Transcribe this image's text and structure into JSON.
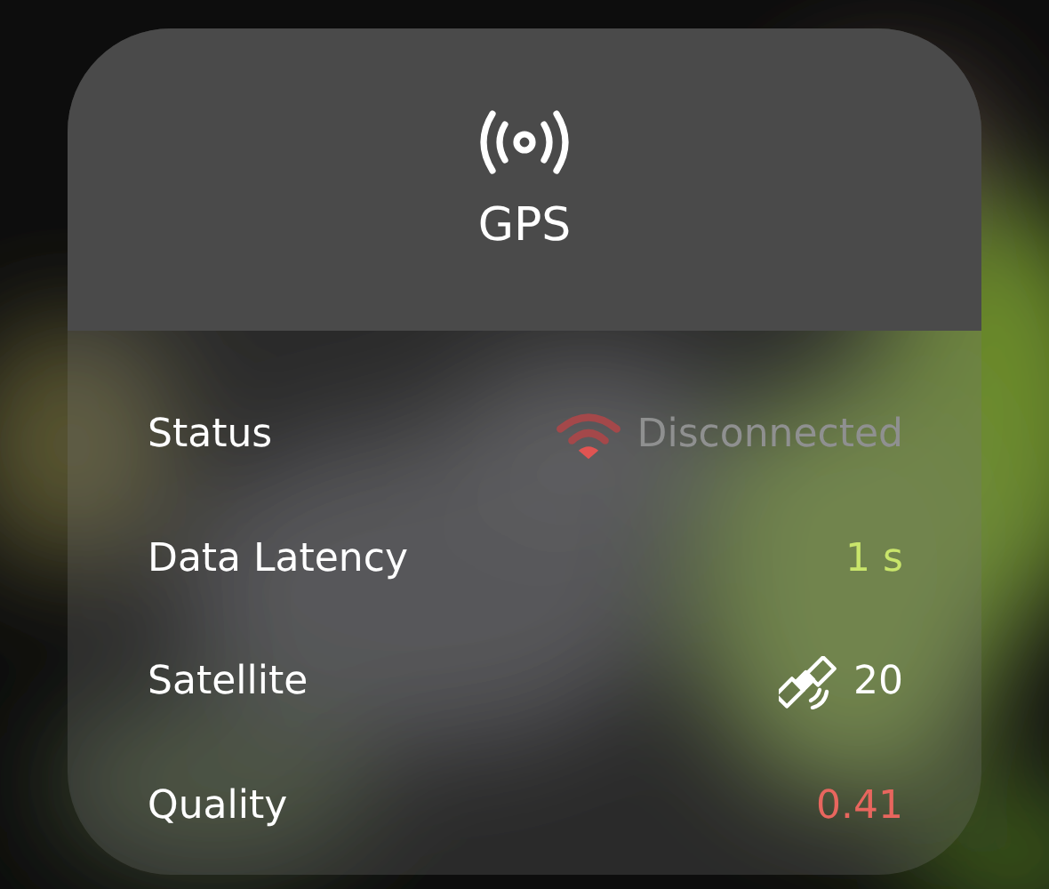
{
  "card": {
    "title": "GPS",
    "rows": [
      {
        "label": "Status",
        "kind": "status",
        "value": "Disconnected",
        "connected": false
      },
      {
        "label": "Data Latency",
        "kind": "plain",
        "value": "1 s",
        "color": "#c9e56b"
      },
      {
        "label": "Satellite",
        "kind": "satellite",
        "value": "20",
        "color": "#ffffff"
      },
      {
        "label": "Quality",
        "kind": "plain",
        "value": "0.41",
        "color": "#e8665e"
      }
    ]
  }
}
